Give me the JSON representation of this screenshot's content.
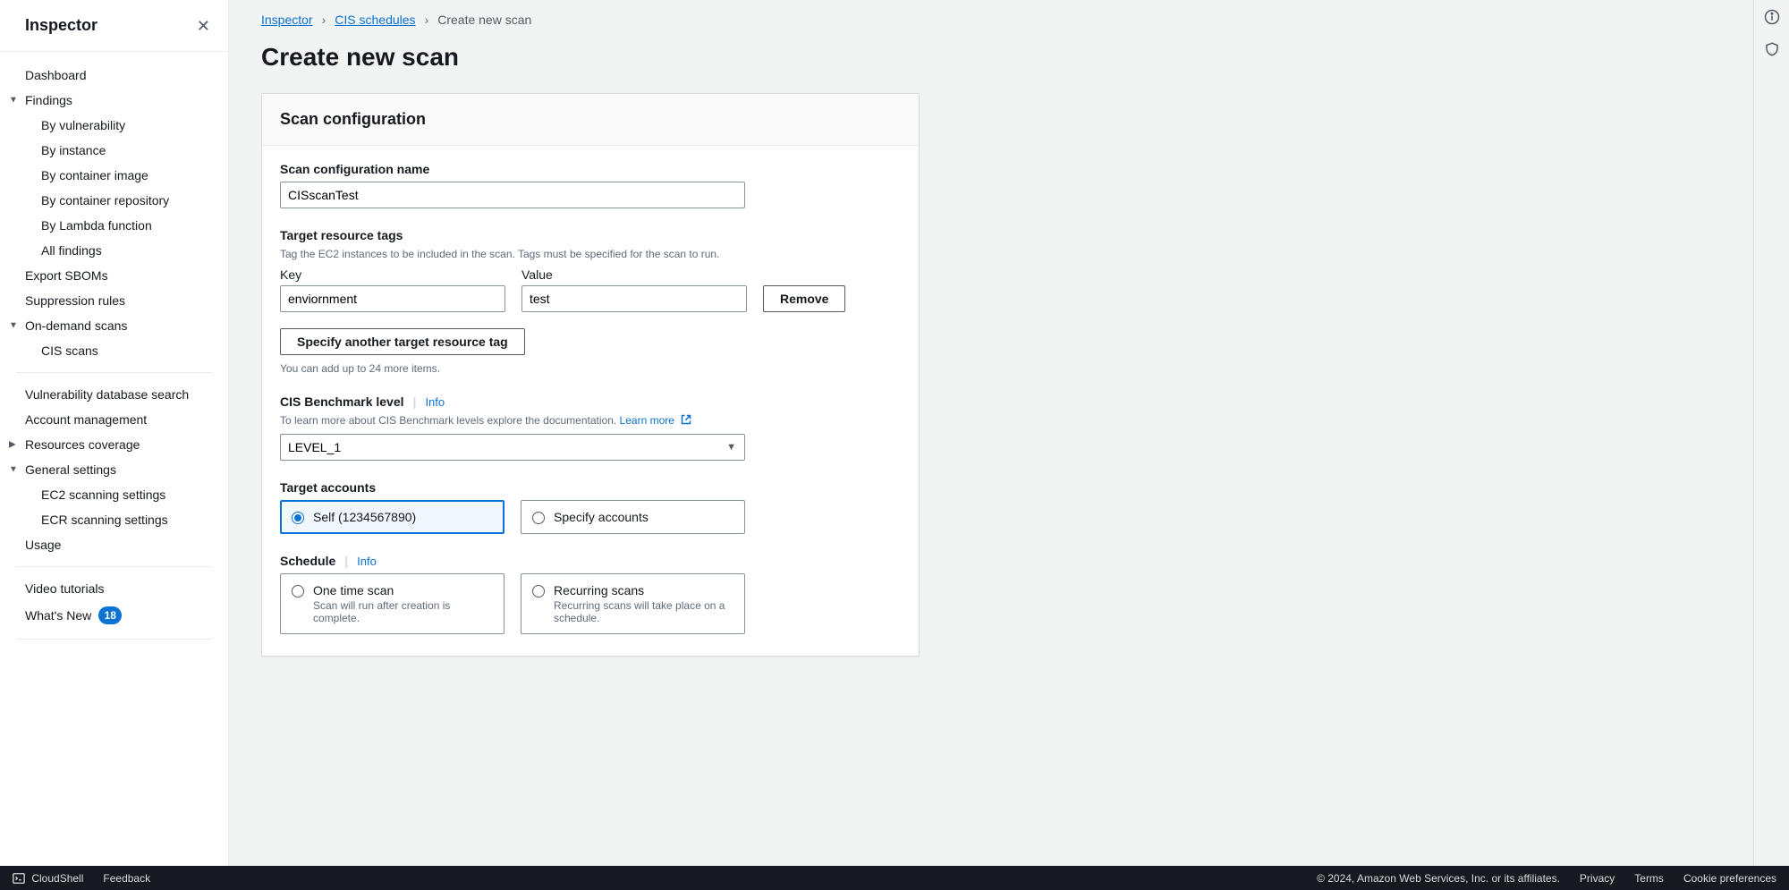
{
  "sidebar": {
    "title": "Inspector",
    "items": {
      "dashboard": "Dashboard",
      "findings": "Findings",
      "by_vuln": "By vulnerability",
      "by_instance": "By instance",
      "by_container_image": "By container image",
      "by_container_repo": "By container repository",
      "by_lambda": "By Lambda function",
      "all_findings": "All findings",
      "export_sboms": "Export SBOMs",
      "suppression": "Suppression rules",
      "on_demand": "On-demand scans",
      "cis_scans": "CIS scans",
      "vuln_db": "Vulnerability database search",
      "account_mgmt": "Account management",
      "resources_coverage": "Resources coverage",
      "general_settings": "General settings",
      "ec2_settings": "EC2 scanning settings",
      "ecr_settings": "ECR scanning settings",
      "usage": "Usage",
      "video": "Video tutorials",
      "whats_new": "What's New",
      "whats_new_badge": "18"
    }
  },
  "breadcrumb": {
    "inspector": "Inspector",
    "cis_schedules": "CIS schedules",
    "current": "Create new scan"
  },
  "page": {
    "title": "Create new scan"
  },
  "panel": {
    "header": "Scan configuration",
    "name_label": "Scan configuration name",
    "name_value": "CISscanTest",
    "tags_label": "Target resource tags",
    "tags_help": "Tag the EC2 instances to be included in the scan. Tags must be specified for the scan to run.",
    "key_label": "Key",
    "value_label": "Value",
    "tag_key": "enviornment",
    "tag_value": "test",
    "remove": "Remove",
    "add_tag": "Specify another target resource tag",
    "add_tag_help": "You can add up to 24 more items.",
    "benchmark_label": "CIS Benchmark level",
    "info": "Info",
    "benchmark_help": "To learn more about CIS Benchmark levels explore the documentation. ",
    "learn_more": "Learn more",
    "benchmark_value": "LEVEL_1",
    "accounts_label": "Target accounts",
    "accounts_self": "Self (1234567890)",
    "accounts_specify": "Specify accounts",
    "schedule_label": "Schedule",
    "one_time_title": "One time scan",
    "one_time_sub": "Scan will run after creation is complete.",
    "recurring_title": "Recurring scans",
    "recurring_sub": "Recurring scans will take place on a schedule."
  },
  "footer": {
    "cloudshell": "CloudShell",
    "feedback": "Feedback",
    "copyright": "© 2024, Amazon Web Services, Inc. or its affiliates.",
    "privacy": "Privacy",
    "terms": "Terms",
    "cookies": "Cookie preferences"
  }
}
